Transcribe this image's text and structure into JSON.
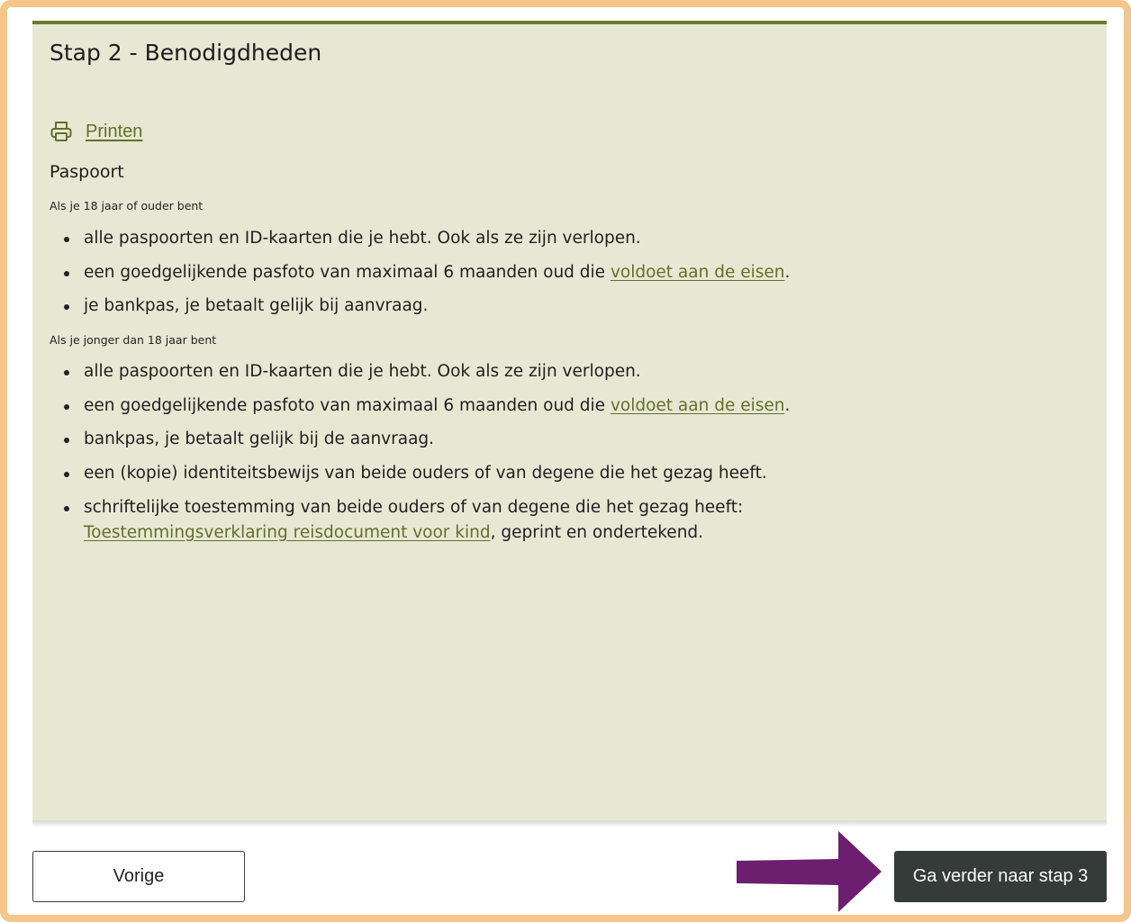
{
  "header": {
    "title": "Stap 2 - Benodigdheden"
  },
  "print": {
    "label": "Printen",
    "icon": "printer-icon"
  },
  "section": {
    "title": "Paspoort"
  },
  "adult": {
    "heading": "Als je 18 jaar of ouder bent",
    "items": [
      {
        "text": "alle paspoorten en ID-kaarten die je hebt. Ook als ze zijn verlopen."
      },
      {
        "pre": "een goedgelijkende pasfoto van maximaal 6 maanden oud die ",
        "link": "voldoet aan de eisen",
        "post": "."
      },
      {
        "text": "je bankpas, je betaalt gelijk bij aanvraag."
      }
    ]
  },
  "minor": {
    "heading": "Als je jonger dan 18 jaar bent",
    "items": [
      {
        "text": "alle paspoorten en ID-kaarten die je hebt. Ook als ze zijn verlopen."
      },
      {
        "pre": "een goedgelijkende pasfoto van maximaal 6 maanden oud die ",
        "link": "voldoet aan de eisen",
        "post": "."
      },
      {
        "text": "bankpas, je betaalt gelijk bij de aanvraag."
      },
      {
        "text": "een (kopie) identiteitsbewijs van beide ouders of van degene die het gezag heeft."
      },
      {
        "pre": "schriftelijke toestemming van beide ouders of van degene die het gezag heeft:",
        "link": "Toestemmingsverklaring reisdocument voor kind",
        "post": ", geprint en ondertekend."
      }
    ]
  },
  "footer": {
    "previous_label": "Vorige",
    "next_label": "Ga verder naar stap 3"
  },
  "colors": {
    "panel_background": "#e7e8d4",
    "panel_border": "#6b7a2b",
    "link": "#627028",
    "primary_button": "#343b38",
    "frame": "#f5c58a",
    "annotation_arrow": "#6b1f6e"
  },
  "annotation": {
    "icon": "arrow-right-icon"
  }
}
